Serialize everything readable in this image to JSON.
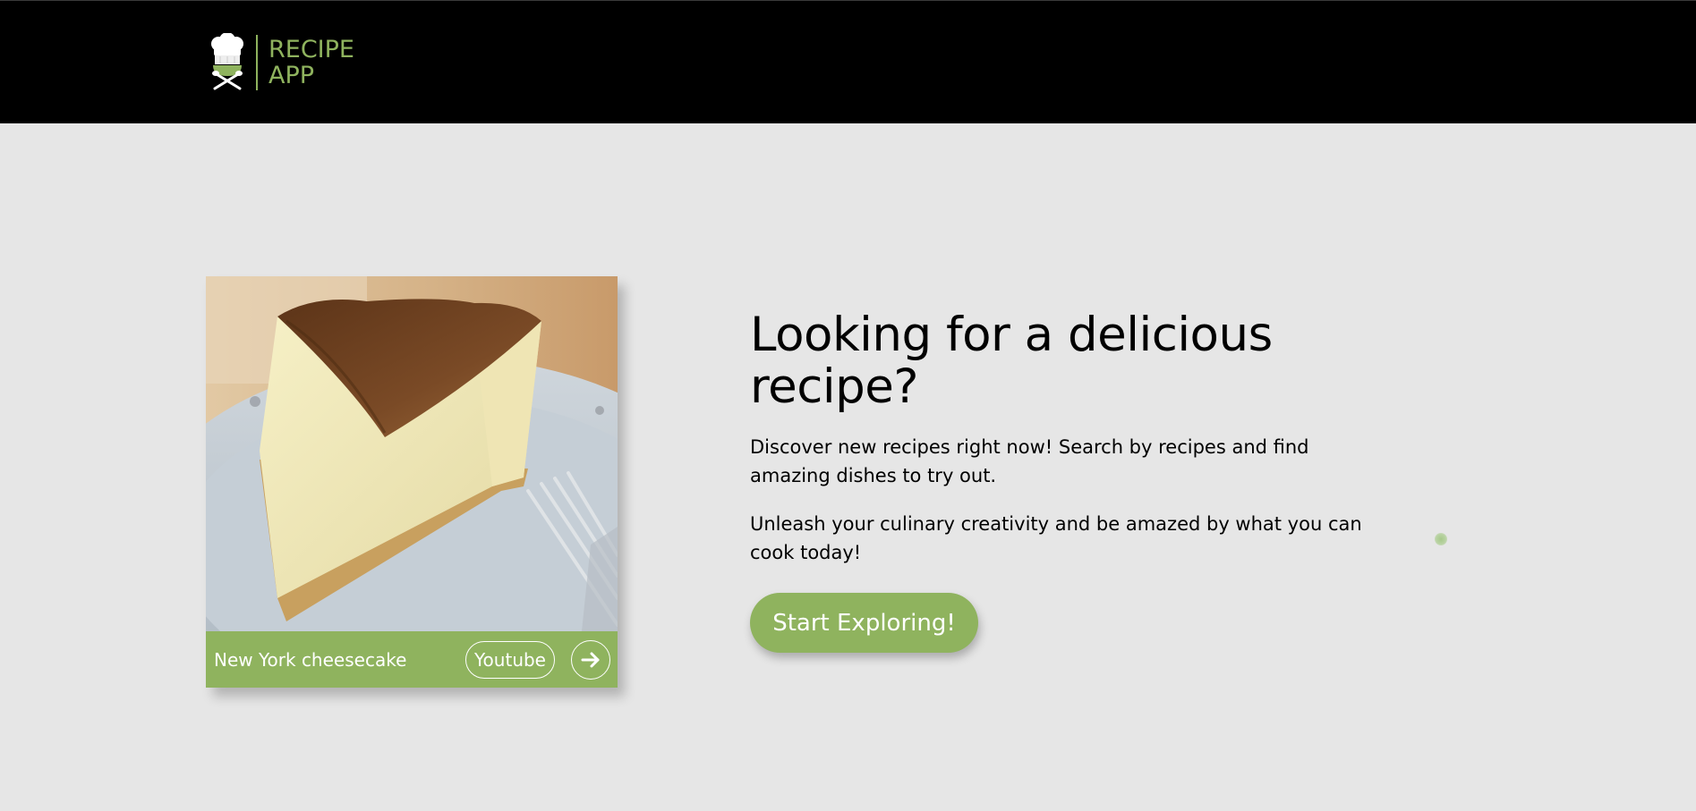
{
  "brand": {
    "line1": "RECIPE",
    "line2": "APP",
    "logo_icon": "chef-hat-icon",
    "accent_color": "#8fb35e"
  },
  "card": {
    "title": "New York cheesecake",
    "image_icon": "cheesecake-photo",
    "youtube_label": "Youtube",
    "arrow_icon": "arrow-right-icon"
  },
  "hero": {
    "title": "Looking for a delicious recipe?",
    "paragraph1": "Discover new recipes right now! Search by recipes and find amazing dishes to try out.",
    "paragraph2": "Unleash your culinary creativity and be amazed by what you can cook today!",
    "cta_label": "Start Exploring!"
  },
  "colors": {
    "header_bg": "#000000",
    "page_bg": "#e6e6e6",
    "accent": "#8fb35e"
  }
}
